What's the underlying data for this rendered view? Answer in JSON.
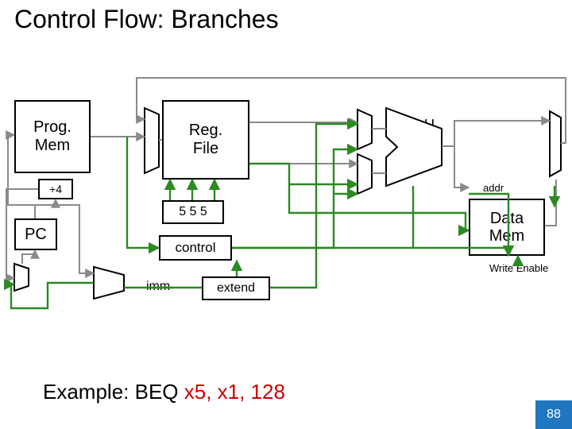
{
  "title": "Control Flow: Branches",
  "blocks": {
    "progmem": "Prog.\nMem",
    "regfile": "Reg.\nFile",
    "alu": "ALU",
    "datamem": "Data\nMem",
    "pc": "PC",
    "plus4": "+4",
    "plus": "+",
    "fivefivefive": "5 5 5",
    "control": "control",
    "imm": "imm",
    "extend": "extend",
    "addr": "addr",
    "write_enable": "Write Enable"
  },
  "example": {
    "prefix": "Example: BEQ ",
    "args": "x5, x1, 128"
  },
  "page": "88",
  "colors": {
    "green": "#2b8a22",
    "grey": "#8a8a8a",
    "blue": "#1f77c0"
  }
}
